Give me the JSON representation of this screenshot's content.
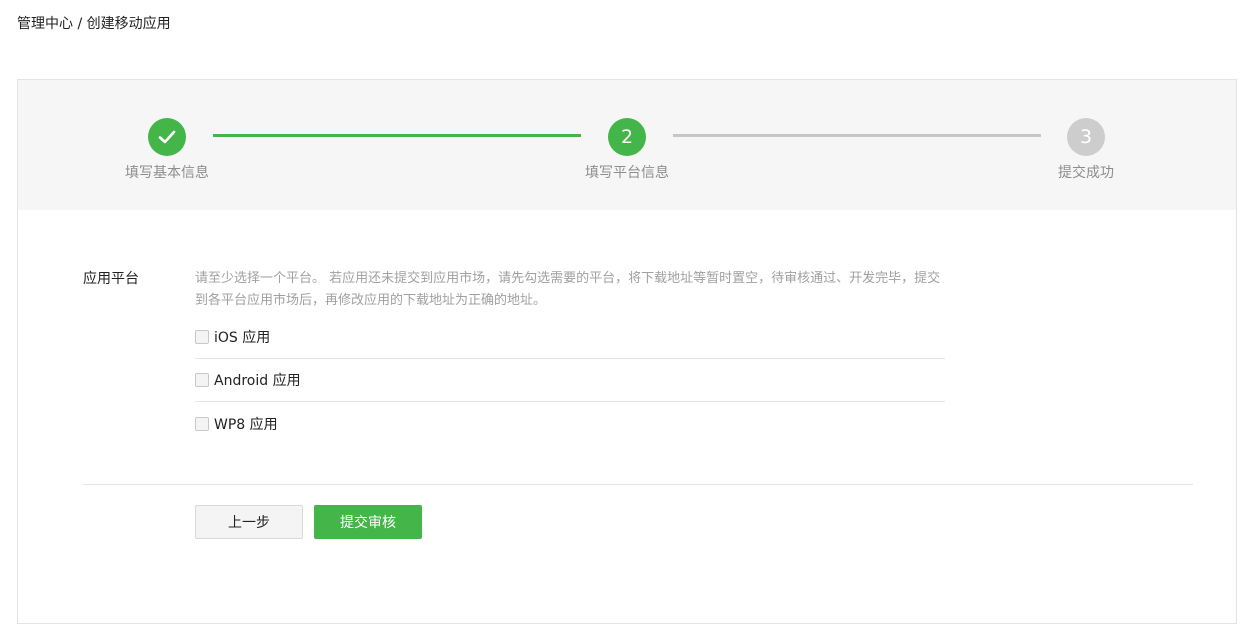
{
  "breadcrumb": {
    "text": "管理中心 / 创建移动应用"
  },
  "steps": [
    {
      "label": "填写基本信息",
      "number": "",
      "status": "done",
      "icon": "check-icon"
    },
    {
      "label": "填写平台信息",
      "number": "2",
      "status": "active"
    },
    {
      "label": "提交成功",
      "number": "3",
      "status": "pending"
    }
  ],
  "form": {
    "platform_label": "应用平台",
    "tip": "请至少选择一个平台。 若应用还未提交到应用市场，请先勾选需要的平台，将下载地址等暂时置空，待审核通过、开发完毕，提交到各平台应用市场后，再修改应用的下载地址为正确的地址。",
    "options": [
      {
        "label": "iOS 应用",
        "checked": false
      },
      {
        "label": "Android 应用",
        "checked": false
      },
      {
        "label": "WP8 应用",
        "checked": false
      }
    ]
  },
  "buttons": {
    "prev_label": "上一步",
    "submit_label": "提交审核"
  },
  "colors": {
    "accent": "#44b549",
    "pending": "#cdcdcd",
    "step_bg": "#f6f6f6"
  }
}
